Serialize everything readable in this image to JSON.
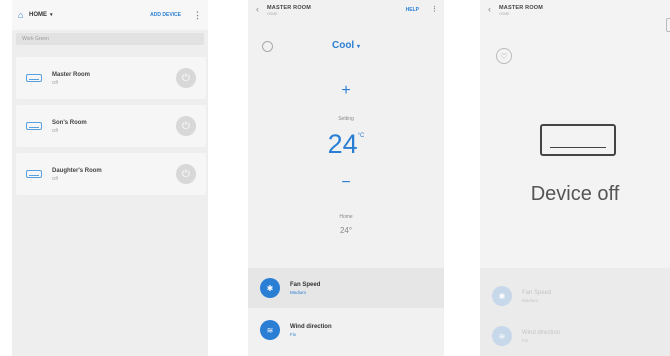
{
  "screen_list": {
    "header": {
      "home_label": "HOME",
      "add_label": "ADD DEVICE",
      "more": "⋮"
    },
    "search_placeholder": "Work Green",
    "rooms": [
      {
        "name": "Master Room",
        "status": "Off"
      },
      {
        "name": "Son's Room",
        "status": "Off"
      },
      {
        "name": "Daughter's Room",
        "status": "Off"
      }
    ]
  },
  "screen_control": {
    "header": {
      "title": "MASTER ROOM",
      "subtitle": "HOME",
      "help": "HELP",
      "more": "⋮",
      "back": "‹"
    },
    "mode": "Cool",
    "mode_caret": "▾",
    "plus": "+",
    "minus": "−",
    "setting_label": "Setting",
    "setting_value": "24",
    "setting_unit": "°C",
    "home_label": "Home",
    "home_value": "24°",
    "options": [
      {
        "name": "Fan Speed",
        "value": "Medium"
      },
      {
        "name": "Wind direction",
        "value": "Fix"
      }
    ]
  },
  "screen_off": {
    "header": {
      "title": "MASTER ROOM",
      "subtitle": "HOME",
      "back": "‹"
    },
    "status": "Device off",
    "options": [
      {
        "name": "Fan Speed",
        "value": "Medium"
      },
      {
        "name": "Wind direction",
        "value": "Fix"
      }
    ]
  },
  "colors": {
    "accent": "#2a7fd4",
    "background": "#f1f1f1",
    "card": "#f6f6f6"
  }
}
